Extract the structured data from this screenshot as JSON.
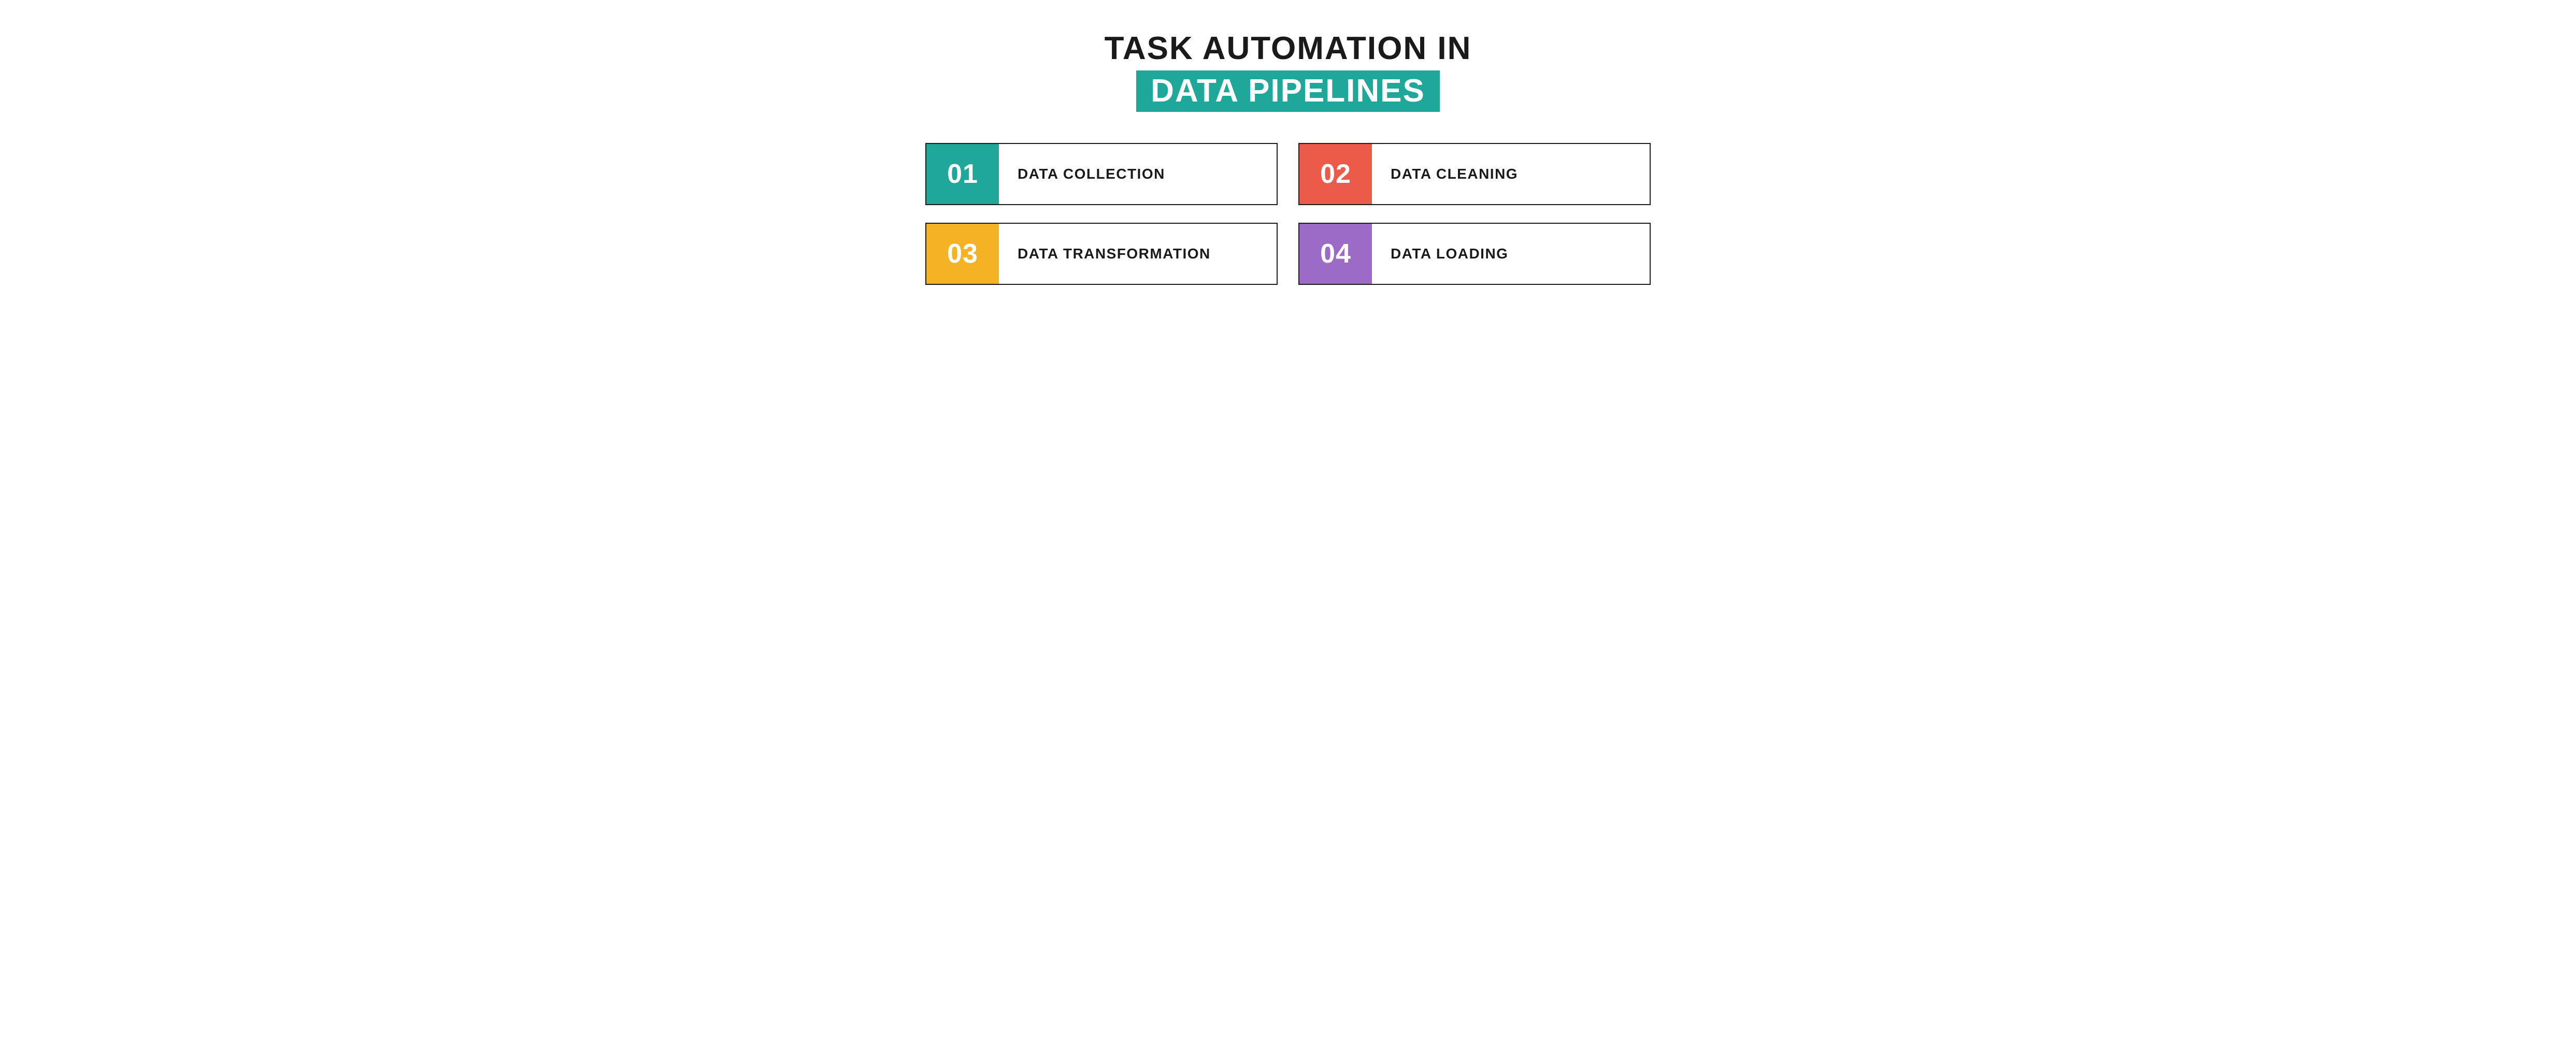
{
  "title": {
    "line1": "TASK AUTOMATION IN",
    "line2": "DATA PIPELINES"
  },
  "colors": {
    "teal": "#1fa79a",
    "red": "#ec5b4a",
    "yellow": "#f5b324",
    "purple": "#9b6bc6",
    "text": "#1a1a1a"
  },
  "steps": [
    {
      "num": "01",
      "label": "DATA COLLECTION",
      "color": "teal"
    },
    {
      "num": "02",
      "label": "DATA CLEANING",
      "color": "red"
    },
    {
      "num": "03",
      "label": "DATA TRANSFORMATION",
      "color": "yellow"
    },
    {
      "num": "04",
      "label": "DATA LOADING",
      "color": "purple"
    }
  ]
}
